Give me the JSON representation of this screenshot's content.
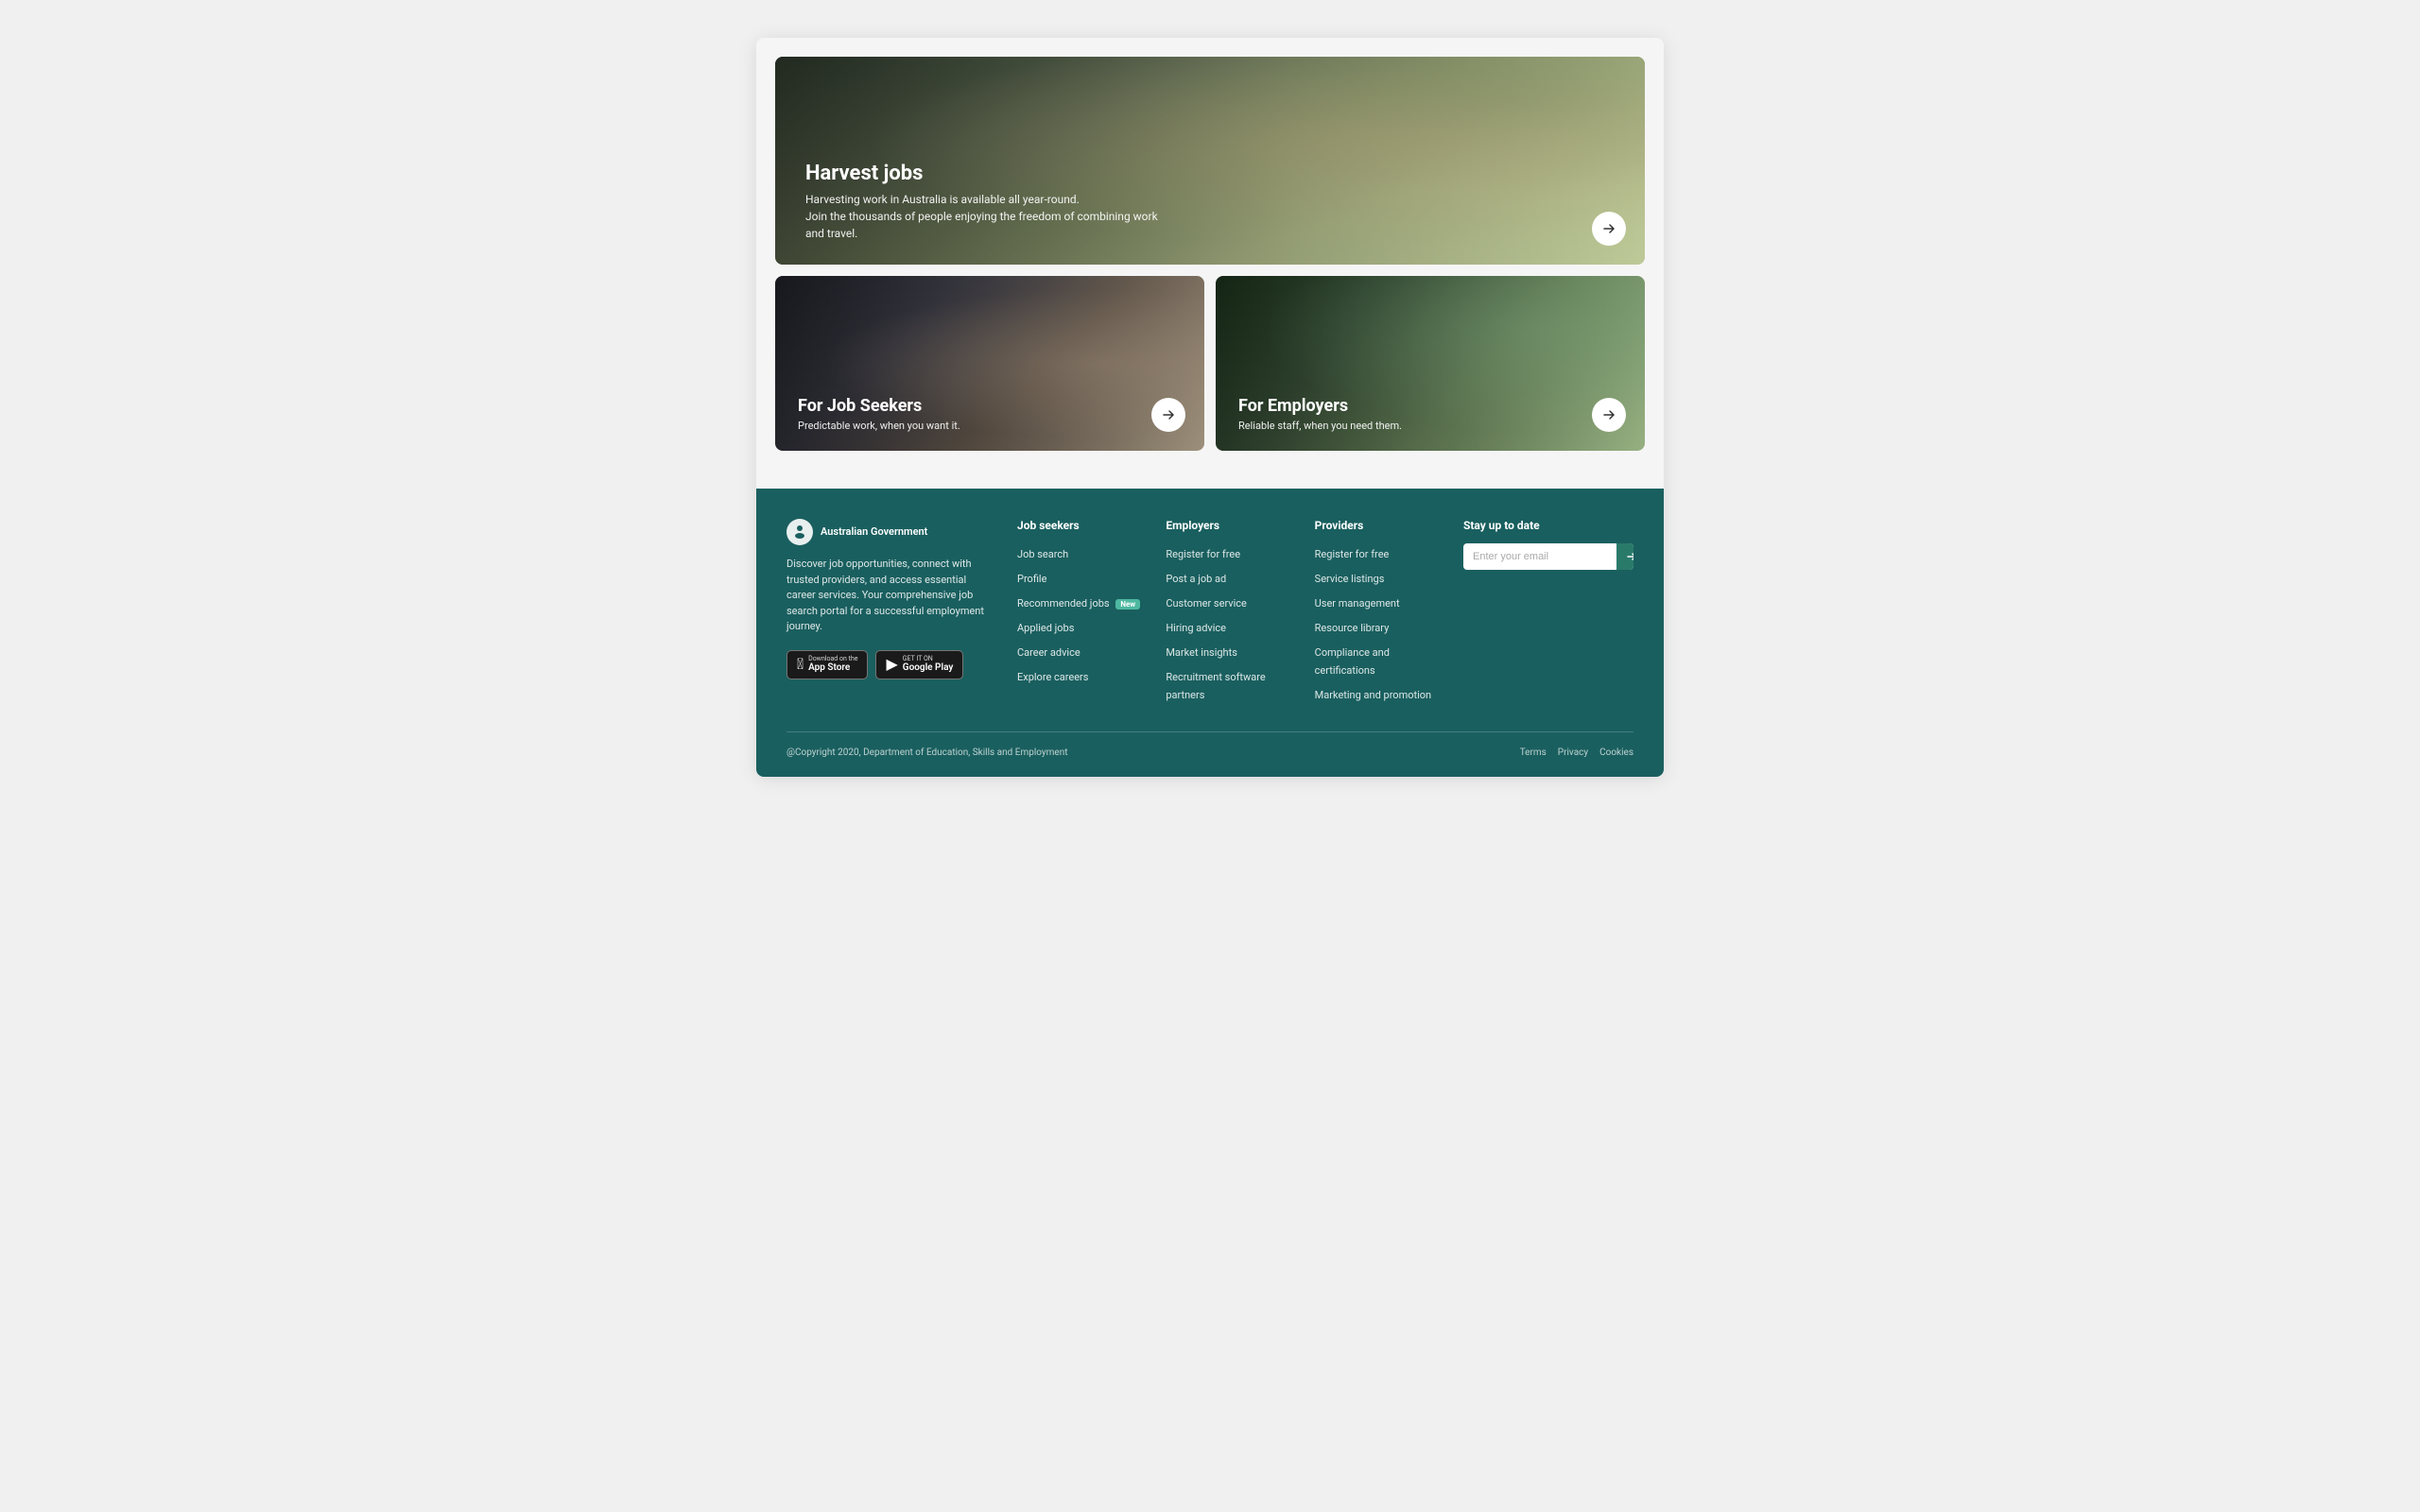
{
  "hero": {
    "title": "Harvest jobs",
    "description_line1": "Harvesting work in Australia is available all year-round.",
    "description_line2": "Join the thousands of people enjoying the freedom of combining work and travel."
  },
  "cards": [
    {
      "id": "job-seekers",
      "title": "For Job Seekers",
      "description": "Predictable work, when you want it."
    },
    {
      "id": "employers",
      "title": "For Employers",
      "description": "Reliable staff, when you need them."
    }
  ],
  "footer": {
    "brand": {
      "gov_label": "Australian Government",
      "description": "Discover job opportunities, connect with trusted providers, and access essential career services. Your comprehensive job search portal for a successful employment journey.",
      "app_store_label": "App Store",
      "google_play_label": "Google Play",
      "app_store_sub": "Download on the",
      "google_play_sub": "GET IT ON"
    },
    "columns": [
      {
        "heading": "Job seekers",
        "links": [
          {
            "label": "Job search",
            "new": false
          },
          {
            "label": "Profile",
            "new": false
          },
          {
            "label": "Recommended jobs",
            "new": true
          },
          {
            "label": "Applied jobs",
            "new": false
          },
          {
            "label": "Career advice",
            "new": false
          },
          {
            "label": "Explore careers",
            "new": false
          }
        ]
      },
      {
        "heading": "Employers",
        "links": [
          {
            "label": "Register for free",
            "new": false
          },
          {
            "label": "Post a job ad",
            "new": false
          },
          {
            "label": "Customer service",
            "new": false
          },
          {
            "label": "Hiring advice",
            "new": false
          },
          {
            "label": "Market insights",
            "new": false
          },
          {
            "label": "Recruitment software partners",
            "new": false
          }
        ]
      },
      {
        "heading": "Providers",
        "links": [
          {
            "label": "Register for free",
            "new": false
          },
          {
            "label": "Service listings",
            "new": false
          },
          {
            "label": "User management",
            "new": false
          },
          {
            "label": "Resource library",
            "new": false
          },
          {
            "label": "Compliance and certifications",
            "new": false
          },
          {
            "label": "Marketing and promotion",
            "new": false
          }
        ]
      }
    ],
    "stay_updated": {
      "heading": "Stay up to date",
      "email_placeholder": "Enter your email"
    },
    "bottom": {
      "copyright": "@Copyright 2020, Department of Education, Skills and Employment",
      "links": [
        "Terms",
        "Privacy",
        "Cookies"
      ]
    }
  }
}
